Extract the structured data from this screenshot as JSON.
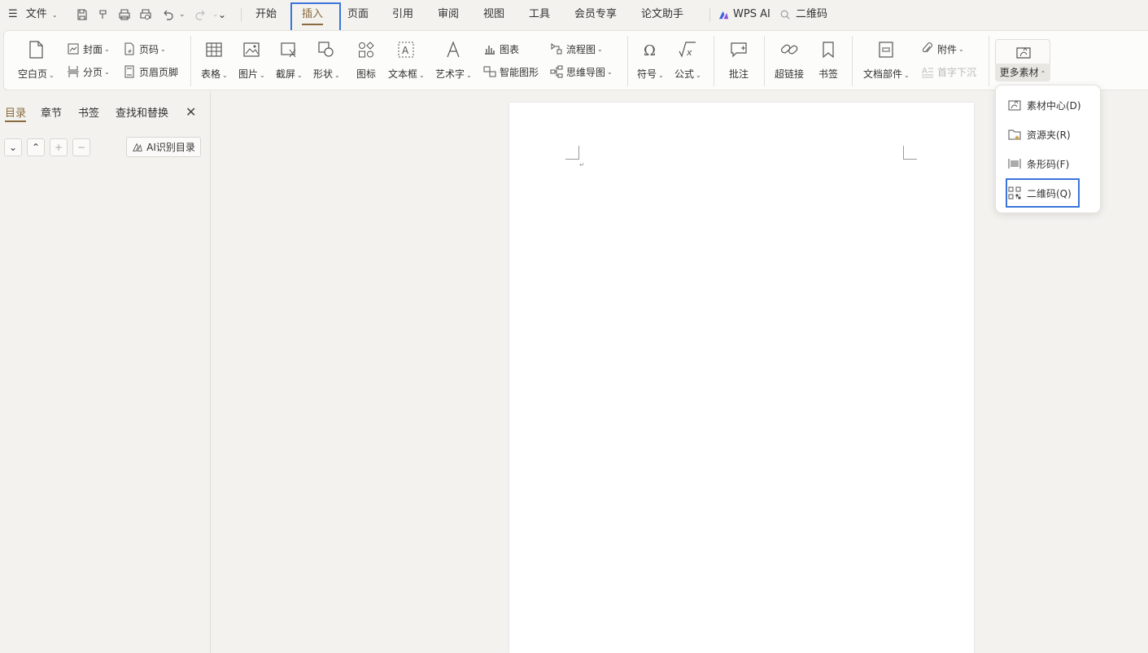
{
  "menubar": {
    "file_label": "文件",
    "tabs": [
      "开始",
      "插入",
      "页面",
      "引用",
      "审阅",
      "视图",
      "工具",
      "会员专享",
      "论文助手"
    ],
    "ai_label": "WPS AI",
    "search_text": "二维码"
  },
  "ribbon": {
    "blank_page": "空白页",
    "cover": "封面",
    "page_number": "页码",
    "page_break": "分页",
    "header_footer": "页眉页脚",
    "table": "表格",
    "picture": "图片",
    "screenshot": "截屏",
    "shape": "形状",
    "icon": "图标",
    "textbox": "文本框",
    "wordart": "艺术字",
    "chart": "图表",
    "smart_graphic": "智能图形",
    "flowchart": "流程图",
    "mindmap": "思维导图",
    "symbol": "符号",
    "formula": "公式",
    "comment": "批注",
    "hyperlink": "超链接",
    "bookmark": "书签",
    "doc_parts": "文档部件",
    "attachment": "附件",
    "drop_cap": "首字下沉",
    "more_materials": "更多素材"
  },
  "nav": {
    "tabs": [
      "目录",
      "章节",
      "书签",
      "查找和替换"
    ],
    "ai_toc": "AI识别目录"
  },
  "dropdown": {
    "items": [
      "素材中心(D)",
      "资源夹(R)",
      "条形码(F)",
      "二维码(Q)"
    ]
  },
  "colors": {
    "accent": "#8b6a3e",
    "highlight": "#3b74db",
    "background": "#f3f2ef"
  }
}
